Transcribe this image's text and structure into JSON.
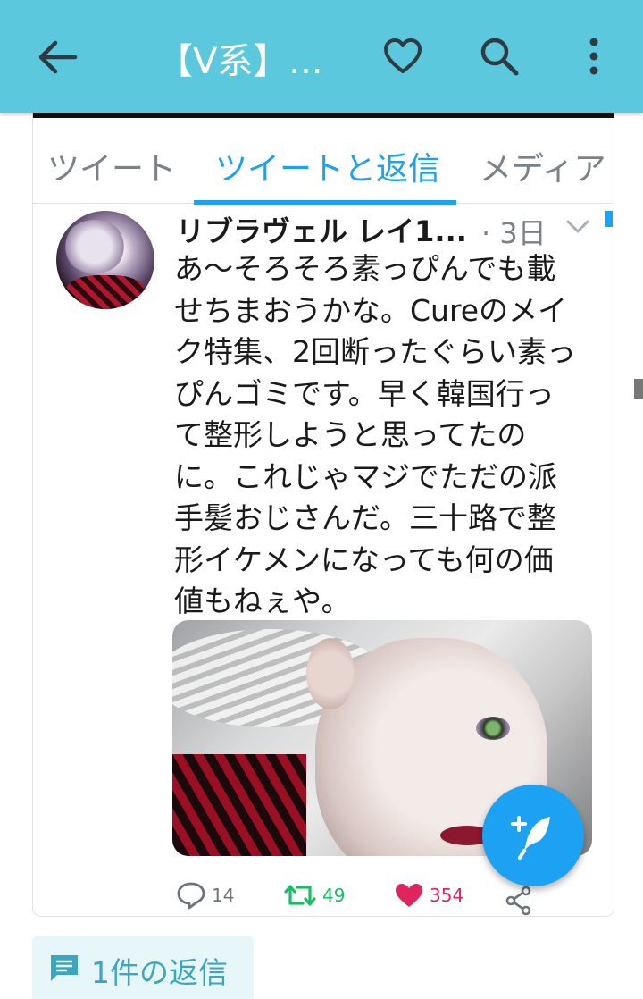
{
  "app_bar": {
    "title": "【V系】...",
    "icons": [
      "back-arrow-icon",
      "heart-outline-icon",
      "search-icon",
      "more-vert-icon"
    ],
    "color": "#5bc8dd"
  },
  "tabs": [
    {
      "label": "ツイート",
      "active": false
    },
    {
      "label": "ツイートと返信",
      "active": true
    },
    {
      "label": "メディア",
      "active": false
    }
  ],
  "tweet": {
    "author": "リブラヴェル レイ1...",
    "time": "· 3日",
    "text_lines": [
      "あ〜そろそろ素っぴんでも載",
      "せちまおうかな。Cureのメイ",
      "ク特集、2回断ったぐらい素っ",
      "ぴんゴミです。早く韓国行っ",
      "て整形しようと思ってたの",
      "に。これじゃマジでただの派",
      "手髪おじさんだ。三十路で整",
      "形イケメンになっても何の価",
      "値もねぇや。"
    ],
    "replies": "14",
    "retweets": "49",
    "likes": "354",
    "colors": {
      "retweet": "#17bf63",
      "like": "#e0245e",
      "accent": "#1da1f2"
    }
  },
  "replies_chip": {
    "label": "1件の返信",
    "icon": "comment-icon"
  },
  "fab": {
    "icon": "compose-tweet-icon"
  }
}
